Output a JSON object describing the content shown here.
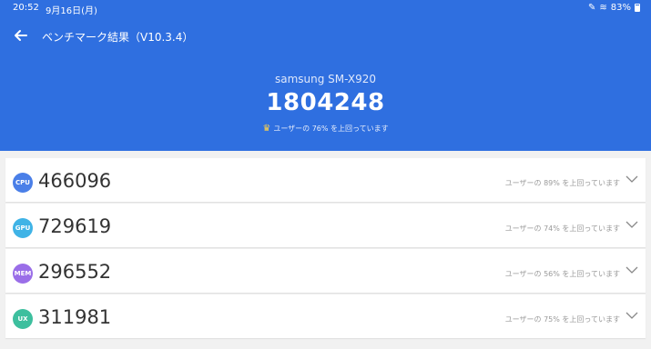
{
  "status_bar": {
    "time": "20:52",
    "date": "9月16日(月)",
    "battery": "83%"
  },
  "header": {
    "title": "ベンチマーク結果（V10.3.4）",
    "device": "samsung SM-X920",
    "total_score": "1804248",
    "rank_text": "ユーザーの 76% を上回っています"
  },
  "results": [
    {
      "badge": "CPU",
      "score": "466096",
      "percent_text": "ユーザーの 89% を上回っています",
      "color": "#4a7fe8"
    },
    {
      "badge": "GPU",
      "score": "729619",
      "percent_text": "ユーザーの 74% を上回っています",
      "color": "#3fb3e6"
    },
    {
      "badge": "MEM",
      "score": "296552",
      "percent_text": "ユーザーの 56% を上回っています",
      "color": "#9a6ee8"
    },
    {
      "badge": "UX",
      "score": "311981",
      "percent_text": "ユーザーの 75% を上回っています",
      "color": "#3dbf9e"
    }
  ],
  "icons": {
    "back": "back-arrow-icon",
    "expand": "chevron-down-icon",
    "rank": "crown-icon"
  }
}
